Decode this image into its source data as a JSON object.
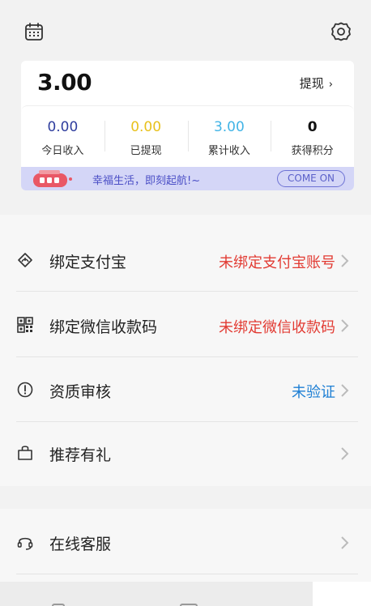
{
  "header": {
    "calendar_icon": "calendar-icon",
    "settings_icon": "gear-icon"
  },
  "wallet": {
    "balance": "3.00",
    "withdraw_label": "提现",
    "withdraw_chevron": "›",
    "stats": [
      {
        "value": "0.00",
        "label": "今日收入",
        "color": "#2f3e9e"
      },
      {
        "value": "0.00",
        "label": "已提现",
        "color": "#e8c11c"
      },
      {
        "value": "3.00",
        "label": "累计收入",
        "color": "#42b4e6"
      },
      {
        "value": "0",
        "label": "获得积分",
        "color": "#111111"
      }
    ],
    "banner": {
      "slogan": "幸福生活，即刻起航!~",
      "button": "COME ON"
    }
  },
  "menu": [
    {
      "title": "绑定支付宝",
      "status": "未绑定支付宝账号",
      "icon": "alipay-icon"
    },
    {
      "title": "绑定微信收款码",
      "status": "未绑定微信收款码",
      "icon": "qrcode-icon"
    },
    {
      "title": "资质审核",
      "status": "未验证",
      "icon": "alert-circle-icon"
    },
    {
      "title": "推荐有礼",
      "status": "",
      "icon": "gift-bag-icon"
    }
  ],
  "support": {
    "title": "在线客服",
    "icon": "headset-icon"
  },
  "colors": {
    "accent_red": "#e23b33",
    "accent_blue": "#1e7fd4",
    "banner_bg": "#d4d6f7"
  }
}
